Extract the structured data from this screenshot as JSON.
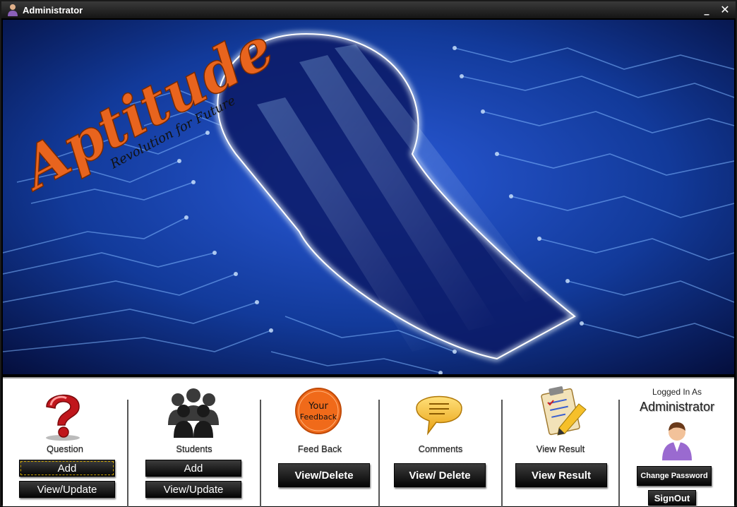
{
  "window": {
    "title": "Administrator"
  },
  "banner": {
    "logo_main": "Aptitude",
    "logo_tagline": "Revolution for Future"
  },
  "sections": {
    "question": {
      "label": "Question",
      "add_label": "Add",
      "view_label": "View/Update"
    },
    "students": {
      "label": "Students",
      "add_label": "Add",
      "view_label": "View/Update"
    },
    "feedback": {
      "label": "Feed Back",
      "icon_text_1": "Your",
      "icon_text_2": "Feedback",
      "action_label": "View/Delete"
    },
    "comments": {
      "label": "Comments",
      "action_label": "View/ Delete"
    },
    "result": {
      "label": "View Result",
      "action_label": "View Result"
    },
    "account": {
      "logged_in_label": "Logged In As",
      "user_name": "Administrator",
      "change_password_label": "Change Password",
      "signout_label": "SignOut"
    }
  },
  "colors": {
    "banner_blue": "#1a3fb0",
    "accent_orange": "#e8641e",
    "button_dark": "#111111"
  }
}
